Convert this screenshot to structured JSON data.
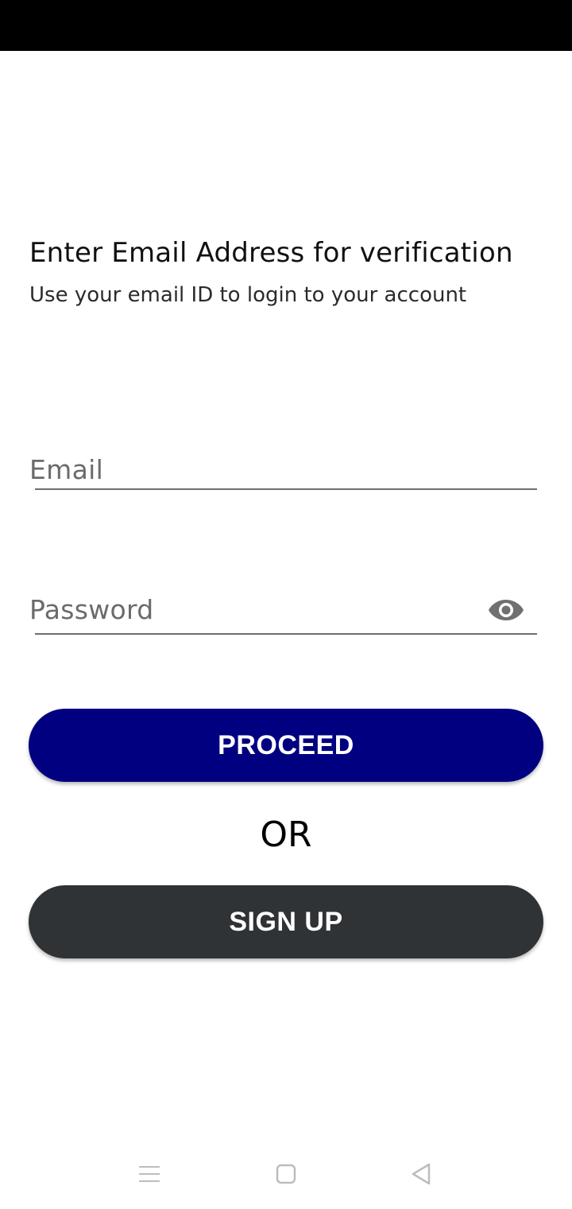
{
  "status_bar": {},
  "header": {
    "title": "Enter Email Address for verification",
    "subtitle": "Use your email ID to login to your account"
  },
  "form": {
    "email": {
      "placeholder": "Email",
      "value": ""
    },
    "password": {
      "placeholder": "Password",
      "value": "",
      "toggle_icon": "eye-icon"
    }
  },
  "actions": {
    "proceed_label": "PROCEED",
    "or_label": "OR",
    "signup_label": "SIGN UP"
  },
  "colors": {
    "proceed_bg": "#010080",
    "signup_bg": "#2f3335",
    "hint_text": "#6b6b6b",
    "status_bar": "#000000"
  },
  "nav_bar": {
    "icons": [
      "menu-icon",
      "home-square-icon",
      "back-triangle-icon"
    ]
  }
}
